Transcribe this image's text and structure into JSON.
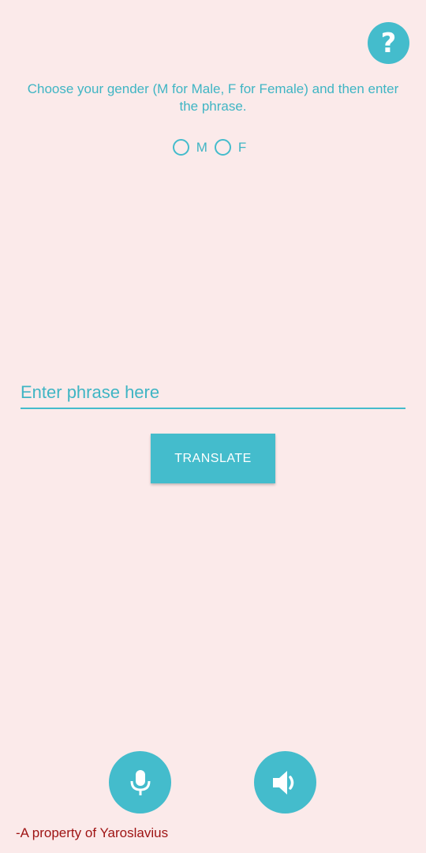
{
  "help": {
    "icon": "question-mark-icon",
    "glyph": "?"
  },
  "instructions": {
    "text": "Choose your gender (M for Male, F for Female) and then enter the phrase."
  },
  "gender": {
    "options": [
      {
        "label": "M",
        "selected": false
      },
      {
        "label": "F",
        "selected": false
      }
    ]
  },
  "phrase_input": {
    "value": "",
    "placeholder": "Enter phrase here"
  },
  "translate_button": {
    "label": "TRANSLATE"
  },
  "actions": {
    "mic_icon": "microphone-icon",
    "speaker_icon": "speaker-icon"
  },
  "footer": {
    "text": "-A property of Yaroslavius"
  },
  "colors": {
    "background": "#fbeaea",
    "accent": "#44bccc",
    "footer_text": "#9e1313"
  }
}
